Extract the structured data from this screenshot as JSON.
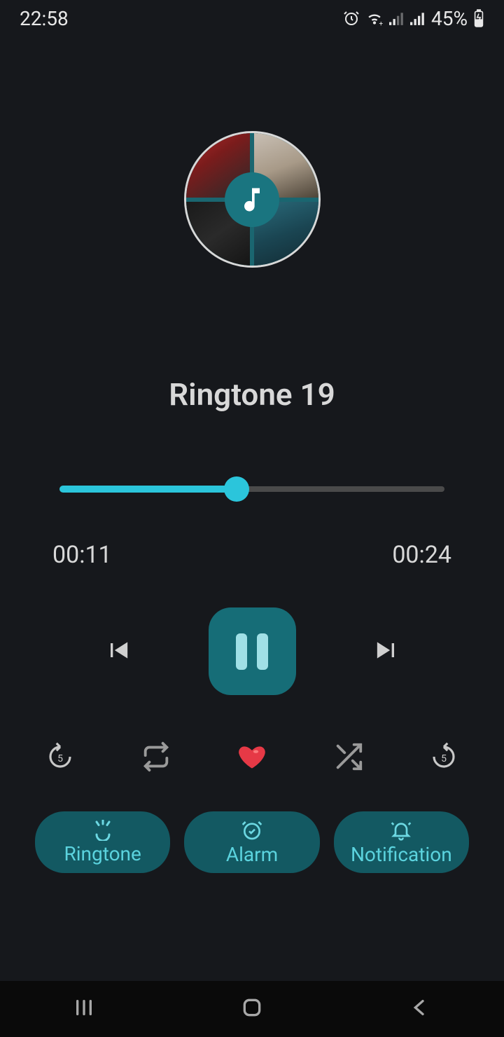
{
  "status": {
    "time": "22:58",
    "battery": "45%"
  },
  "track": {
    "title": "Ringtone 19"
  },
  "player": {
    "elapsed": "00:11",
    "duration": "00:24",
    "progress_pct": 46
  },
  "actions": {
    "ringtone": "Ringtone",
    "alarm": "Alarm",
    "notification": "Notification"
  }
}
